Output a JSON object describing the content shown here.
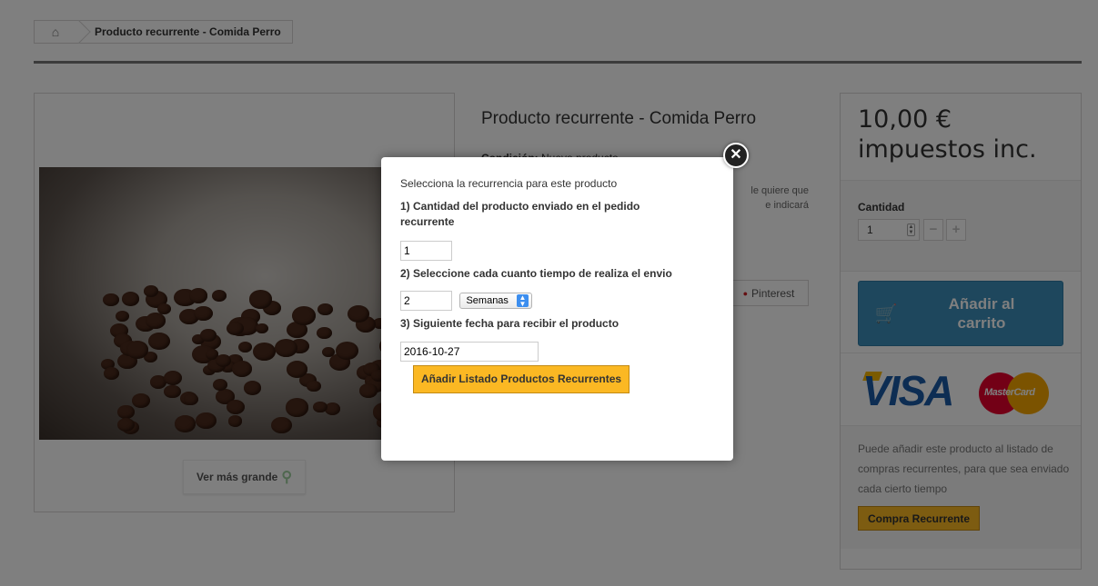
{
  "breadcrumb": {
    "home_icon": "home-icon",
    "current": "Producto recurrente - Comida Perro"
  },
  "product": {
    "title": "Producto recurrente - Comida Perro",
    "condition_label": "Condición:",
    "condition_value": "Nuevo producto",
    "description_fragment_1": "le quiere que",
    "description_fragment_2": "e indicará",
    "view_larger": "Ver más grande",
    "share_pinterest": "Pinterest"
  },
  "buybox": {
    "price": "10,00 €",
    "tax": "impuestos inc.",
    "quantity_label": "Cantidad",
    "quantity_value": "1",
    "minus": "−",
    "plus": "+",
    "add_to_cart_line1": "Añadir al",
    "add_to_cart_line2": "carrito",
    "card_visa": "VISA",
    "card_mastercard": "MasterCard",
    "recurrent_text": "Puede añadir este producto al listado de compras recurrentes, para que sea enviado cada cierto tiempo",
    "recurrent_button": "Compra Recurrente"
  },
  "modal": {
    "title": "Selecciona la recurrencia para este producto",
    "step1_label": "1) Cantidad del producto enviado en el pedido recurrente",
    "step1_value": "1",
    "step2_label": "2) Seleccione cada cuanto tiempo de realiza el envio",
    "step2_value": "2",
    "step2_unit": "Semanas",
    "step3_label": "3) Siguiente fecha para recibir el producto",
    "step3_value": "2016-10-27",
    "submit": "Añadir Listado Productos Recurrentes",
    "close_icon": "close-icon"
  },
  "colors": {
    "accent_yellow": "#fbb823",
    "cart_blue": "#3c8eba",
    "overlay": "rgba(0,0,0,0.5)"
  }
}
